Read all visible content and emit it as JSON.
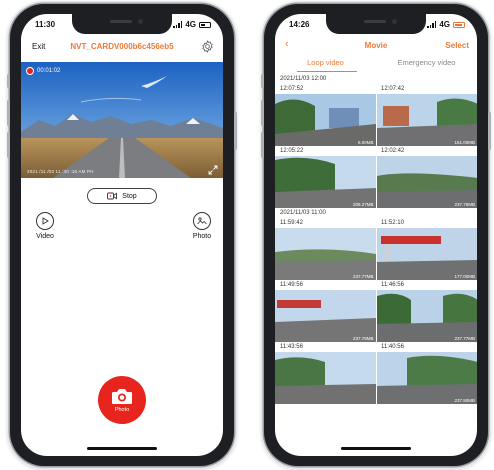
{
  "left_phone": {
    "status": {
      "time": "11:30",
      "network": "4G"
    },
    "header": {
      "exit_label": "Exit",
      "device_name": "NVT_CARDV000b6c456eb5"
    },
    "preview": {
      "rec_timer": "00:01:02",
      "timestamp": "2021 /11 /03  11 :30 :16 AM PH"
    },
    "stop_label": "Stop",
    "video_label": "Video",
    "photo_label": "Photo",
    "shutter_label": "Photo",
    "colors": {
      "accent": "#f07a36",
      "record": "#e8241e"
    }
  },
  "right_phone": {
    "status": {
      "time": "14:26",
      "network": "4G"
    },
    "header": {
      "back_icon": "chevron-left-icon",
      "title": "Movie",
      "select_label": "Select"
    },
    "tabs": [
      {
        "label": "Loop video",
        "active": true
      },
      {
        "label": "Emergency video",
        "active": false
      }
    ],
    "groups": [
      {
        "date": "2021/11/03 12:00",
        "rows": [
          {
            "times": [
              "12:07:52",
              "12:07:42"
            ],
            "sizes": [
              "6.00MB",
              "161.00MB"
            ]
          },
          {
            "times": [
              "12:05:22",
              "12:02:42"
            ],
            "sizes": [
              "209.27MB",
              "237.78MB"
            ]
          }
        ]
      },
      {
        "date": "2021/11/03 11:00",
        "rows": [
          {
            "times": [
              "11:59:42",
              "11:52:10"
            ],
            "sizes": [
              "237.77MB",
              "177.00MB"
            ]
          },
          {
            "times": [
              "11:49:56",
              "11:46:56"
            ],
            "sizes": [
              "237.78MB",
              "237.77MB"
            ]
          },
          {
            "times": [
              "11:43:56",
              "11:40:56"
            ],
            "sizes": [
              "",
              "237.80MB"
            ]
          }
        ]
      }
    ]
  }
}
